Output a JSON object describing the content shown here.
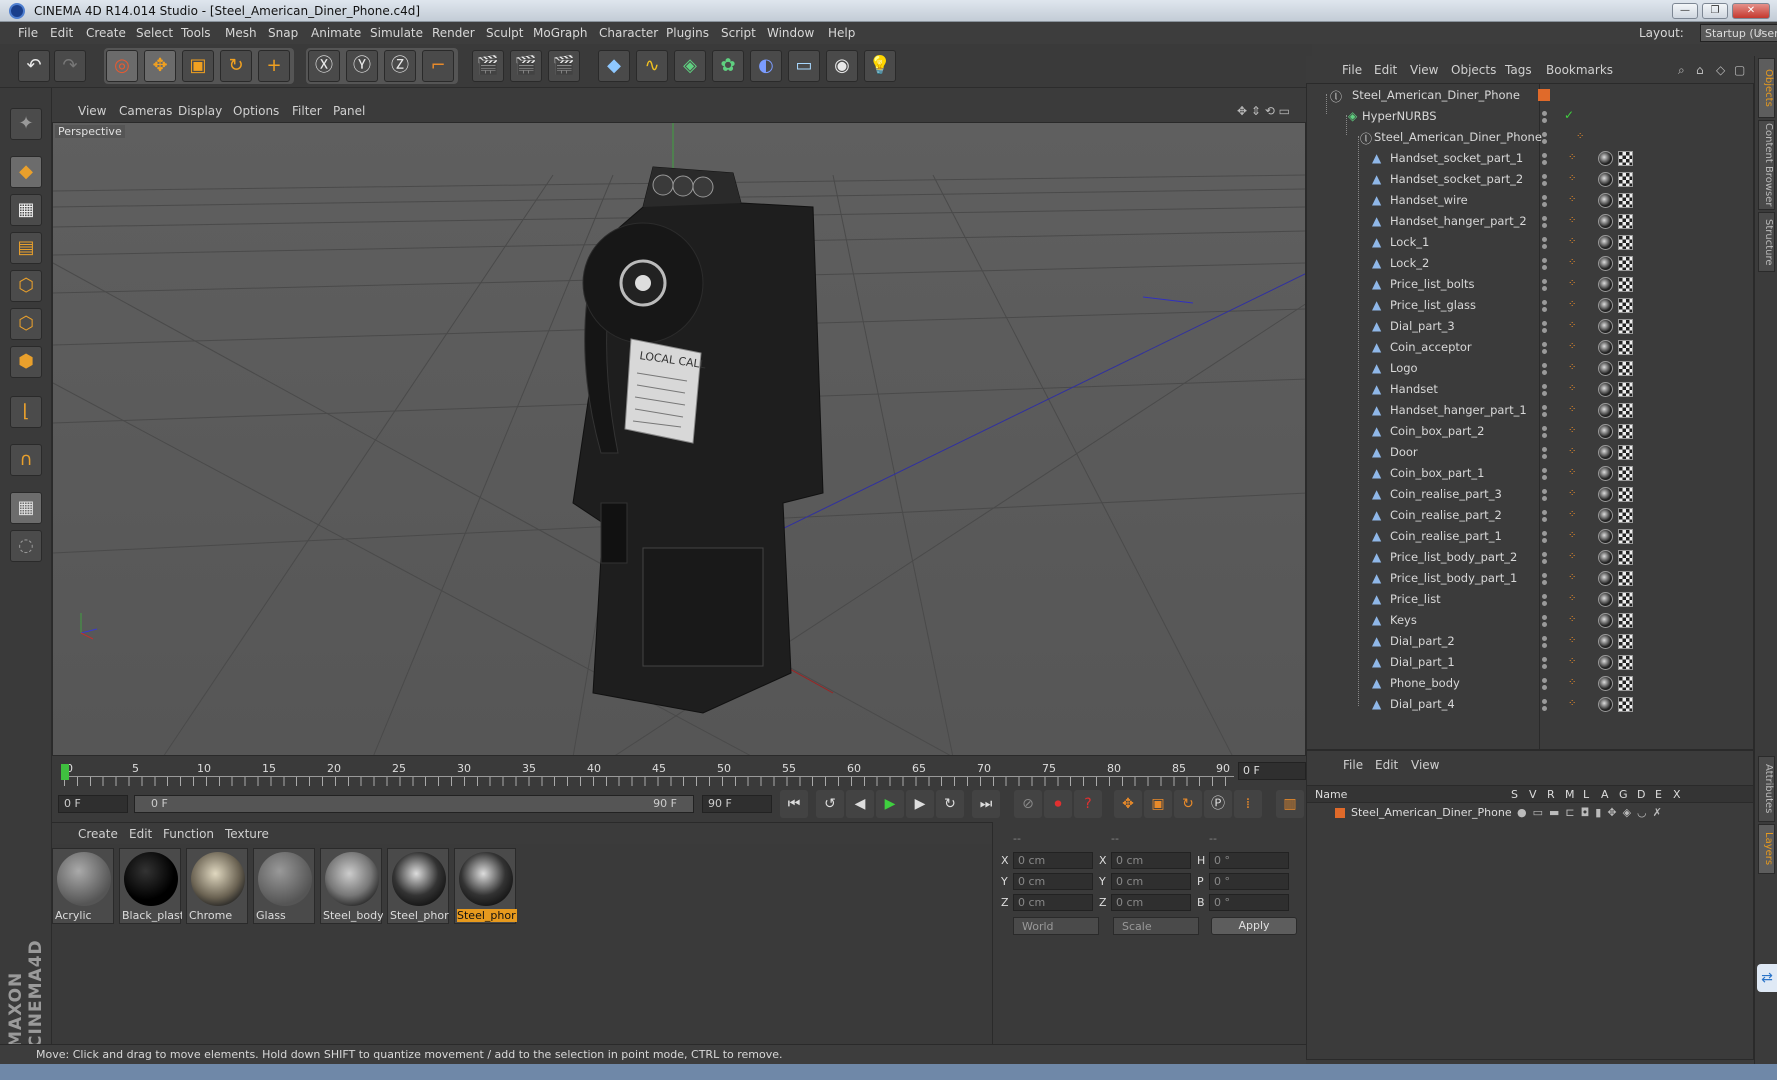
{
  "window": {
    "title": "CINEMA 4D R14.014 Studio - [Steel_American_Diner_Phone.c4d]",
    "minimize": "—",
    "restore": "❐",
    "close": "✕"
  },
  "menubar": [
    "File",
    "Edit",
    "Create",
    "Select",
    "Tools",
    "Mesh",
    "Snap",
    "Animate",
    "Simulate",
    "Render",
    "Sculpt",
    "MoGraph",
    "Character",
    "Plugins",
    "Script",
    "Window",
    "Help"
  ],
  "layout": {
    "label": "Layout:",
    "value": "Startup (User)"
  },
  "viewport": {
    "menu": [
      "View",
      "Cameras",
      "Display",
      "Options",
      "Filter",
      "Panel"
    ],
    "label": "Perspective",
    "signage": "LOCAL CALL"
  },
  "timeline": {
    "ticks": [
      "0",
      "5",
      "10",
      "15",
      "20",
      "25",
      "30",
      "35",
      "40",
      "45",
      "50",
      "55",
      "60",
      "65",
      "70",
      "75",
      "80",
      "85",
      "90"
    ],
    "frame_display": "0 F",
    "start_field": "0 F",
    "range_start": "0 F",
    "range_end": "90 F",
    "end_field": "90 F"
  },
  "materials": {
    "menu": [
      "Create",
      "Edit",
      "Function",
      "Texture"
    ],
    "items": [
      {
        "name": "Acrylic",
        "color": "#7a7a7a"
      },
      {
        "name": "Black_plast",
        "color": "#050505"
      },
      {
        "name": "Chrome",
        "color": "#8a8272"
      },
      {
        "name": "Glass",
        "color": "#6a6a6a"
      },
      {
        "name": "Steel_body",
        "color": "#8c8c8c"
      },
      {
        "name": "Steel_phor",
        "color": "#606060"
      },
      {
        "name": "Steel_phor",
        "color": "#606060"
      }
    ]
  },
  "coords": {
    "headers": [
      "--",
      "--",
      "--"
    ],
    "rows": [
      {
        "a": "X",
        "av": "0 cm",
        "b": "X",
        "bv": "0 cm",
        "c": "H",
        "cv": "0 °"
      },
      {
        "a": "Y",
        "av": "0 cm",
        "b": "Y",
        "bv": "0 cm",
        "c": "P",
        "cv": "0 °"
      },
      {
        "a": "Z",
        "av": "0 cm",
        "b": "Z",
        "bv": "0 cm",
        "c": "B",
        "cv": "0 °"
      }
    ],
    "world": "World",
    "scale": "Scale",
    "apply": "Apply"
  },
  "status": "Move: Click and drag to move elements. Hold down SHIFT to quantize movement / add to the selection in point mode, CTRL to remove.",
  "objects": {
    "menu": [
      "File",
      "Edit",
      "View",
      "Objects",
      "Tags",
      "Bookmarks"
    ],
    "root": "Steel_American_Diner_Phone",
    "nurbs": "HyperNURBS",
    "group": "Steel_American_Diner_Phone",
    "children": [
      "Handset_socket_part_1",
      "Handset_socket_part_2",
      "Handset_wire",
      "Handset_hanger_part_2",
      "Lock_1",
      "Lock_2",
      "Price_list_bolts",
      "Price_list_glass",
      "Dial_part_3",
      "Coin_acceptor",
      "Logo",
      "Handset",
      "Handset_hanger_part_1",
      "Coin_box_part_2",
      "Door",
      "Coin_box_part_1",
      "Coin_realise_part_3",
      "Coin_realise_part_2",
      "Coin_realise_part_1",
      "Price_list_body_part_2",
      "Price_list_body_part_1",
      "Price_list",
      "Keys",
      "Dial_part_2",
      "Dial_part_1",
      "Phone_body",
      "Dial_part_4"
    ]
  },
  "attributes": {
    "menu": [
      "File",
      "Edit",
      "View"
    ],
    "col_name": "Name",
    "cols": [
      "S",
      "V",
      "R",
      "M",
      "L",
      "A",
      "G",
      "D",
      "E",
      "X"
    ],
    "layer_name": "Steel_American_Diner_Phone"
  },
  "sidetabs": [
    "Objects",
    "Content Browser",
    "Structure",
    "Attributes",
    "Layers"
  ]
}
